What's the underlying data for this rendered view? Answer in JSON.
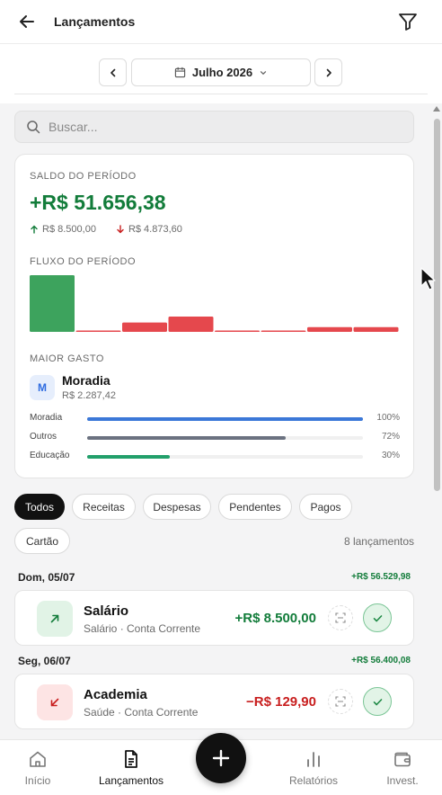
{
  "header": {
    "title": "Lançamentos"
  },
  "month": {
    "label": "Julho 2026"
  },
  "search": {
    "placeholder": "Buscar..."
  },
  "summary": {
    "saldo_label": "SALDO DO PERÍODO",
    "saldo_value": "+R$ 51.656,38",
    "income": "R$ 8.500,00",
    "expense": "R$ 4.873,60",
    "fluxo_label": "FLUXO DO PERÍODO",
    "maior_gasto_label": "MAIOR GASTO",
    "maior_gasto": {
      "initial": "M",
      "name": "Moradia",
      "value": "R$ 2.287,42"
    },
    "categories": [
      {
        "name": "Moradia",
        "pct": "100%",
        "fraction": 1.0,
        "color": "#3b78d8"
      },
      {
        "name": "Outros",
        "pct": "72%",
        "fraction": 0.72,
        "color": "#6b7280"
      },
      {
        "name": "Educação",
        "pct": "30%",
        "fraction": 0.3,
        "color": "#22a06b"
      }
    ]
  },
  "chart_data": {
    "type": "bar",
    "series": [
      {
        "values": [
          8500,
          -60,
          -1400,
          -2287,
          -40,
          -40,
          -700,
          -700
        ]
      }
    ],
    "colors": {
      "positive": "#3da35d",
      "negative": "#e5484d"
    }
  },
  "filters": {
    "chips": [
      "Todos",
      "Receitas",
      "Despesas",
      "Pendentes",
      "Pagos",
      "Cartão"
    ],
    "active": "Todos",
    "count": "8 lançamentos"
  },
  "days": [
    {
      "date": "Dom, 05/07",
      "total": "+R$ 56.529,98",
      "tx": {
        "name": "Salário",
        "sub": "Salário · Conta Corrente",
        "amount": "+R$ 8.500,00",
        "type": "income"
      }
    },
    {
      "date": "Seg, 06/07",
      "total": "+R$ 56.400,08",
      "tx": {
        "name": "Academia",
        "sub": "Saúde · Conta Corrente",
        "amount": "−R$ 129,90",
        "type": "expense"
      }
    }
  ],
  "nav": {
    "items": [
      "Início",
      "Lançamentos",
      "Relatórios",
      "Invest."
    ],
    "active": "Lançamentos"
  },
  "colors": {
    "green": "#127c3a",
    "red": "#c81e1e",
    "accent_dark": "#111111"
  }
}
